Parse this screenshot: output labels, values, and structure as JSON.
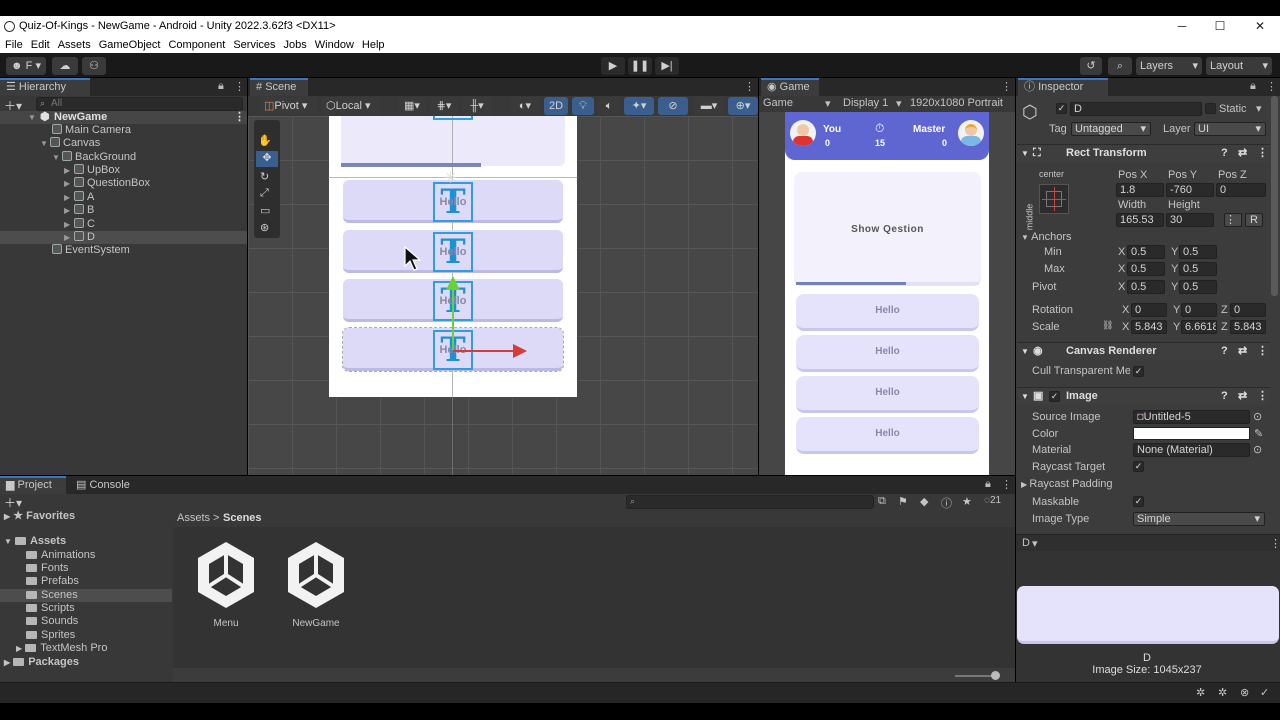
{
  "window": {
    "title": "Quiz-Of-Kings - NewGame - Android - Unity 2022.3.62f3 <DX11>",
    "minimize": "─",
    "maximize": "☐",
    "close": "✕"
  },
  "menu": [
    "File",
    "Edit",
    "Assets",
    "GameObject",
    "Component",
    "Services",
    "Jobs",
    "Window",
    "Help"
  ],
  "toolbar": {
    "account": "F",
    "layers": "Layers",
    "layout": "Layout"
  },
  "hierarchy": {
    "tab": "Hierarchy",
    "search_placeholder": "All",
    "items": [
      {
        "label": "NewGame"
      },
      {
        "label": "Main Camera"
      },
      {
        "label": "Canvas"
      },
      {
        "label": "BackGround"
      },
      {
        "label": "UpBox"
      },
      {
        "label": "QuestionBox"
      },
      {
        "label": "A"
      },
      {
        "label": "B"
      },
      {
        "label": "C"
      },
      {
        "label": "D"
      },
      {
        "label": "EventSystem"
      }
    ]
  },
  "scene": {
    "tab": "Scene",
    "pivot": "Pivot",
    "local": "Local",
    "two_d": "2D",
    "hello": "Hello"
  },
  "game": {
    "tab": "Game",
    "mode": "Game",
    "display": "Display 1",
    "resolution": "1920x1080 Portrait",
    "player_name": "You",
    "player_score": "0",
    "timer": "15",
    "opponent_name": "Master",
    "opponent_score": "0",
    "question": "Show Qestion",
    "answers": [
      "Hello",
      "Hello",
      "Hello",
      "Hello"
    ],
    "timer_progress": 0.6
  },
  "inspector": {
    "tab": "Inspector",
    "object_name": "D",
    "static_label": "Static",
    "tag_label": "Tag",
    "tag_value": "Untagged",
    "layer_label": "Layer",
    "layer_value": "UI",
    "rect_transform": "Rect Transform",
    "anchor_h": "center",
    "anchor_v": "middle",
    "posx_label": "Pos X",
    "posy_label": "Pos Y",
    "posz_label": "Pos Z",
    "posx": "1.8",
    "posy": "-760",
    "posz": "0",
    "width_label": "Width",
    "height_label": "Height",
    "width": "165.53",
    "height": "30",
    "anchors": "Anchors",
    "min": "Min",
    "max": "Max",
    "min_x": "0.5",
    "min_y": "0.5",
    "max_x": "0.5",
    "max_y": "0.5",
    "pivot": "Pivot",
    "pivot_x": "0.5",
    "pivot_y": "0.5",
    "rotation": "Rotation",
    "rot_x": "0",
    "rot_y": "0",
    "rot_z": "0",
    "scale": "Scale",
    "scale_x": "5.843",
    "scale_y": "6.6618",
    "scale_z": "5.843",
    "canvas_renderer": "Canvas Renderer",
    "cull_transparent": "Cull Transparent Mes",
    "image": "Image",
    "source_image_label": "Source Image",
    "source_image": "Untitled-5",
    "color_label": "Color",
    "material_label": "Material",
    "material": "None (Material)",
    "raycast_target": "Raycast Target",
    "raycast_padding": "Raycast Padding",
    "maskable": "Maskable",
    "image_type_label": "Image Type",
    "image_type": "Simple",
    "preview_name": "D",
    "preview_title": "D",
    "image_size": "Image Size: 1045x237",
    "r_button": "R",
    "x": "X",
    "y": "Y",
    "z": "Z"
  },
  "project": {
    "tab_project": "Project",
    "tab_console": "Console",
    "favorites": "Favorites",
    "assets": "Assets",
    "folders": [
      "Animations",
      "Fonts",
      "Prefabs",
      "Scenes",
      "Scripts",
      "Sounds",
      "Sprites",
      "TextMesh Pro"
    ],
    "packages": "Packages",
    "breadcrumb_root": "Assets",
    "breadcrumb_sep": ">",
    "breadcrumb_current": "Scenes",
    "files": [
      "Menu",
      "NewGame"
    ],
    "badge_count": "21"
  }
}
